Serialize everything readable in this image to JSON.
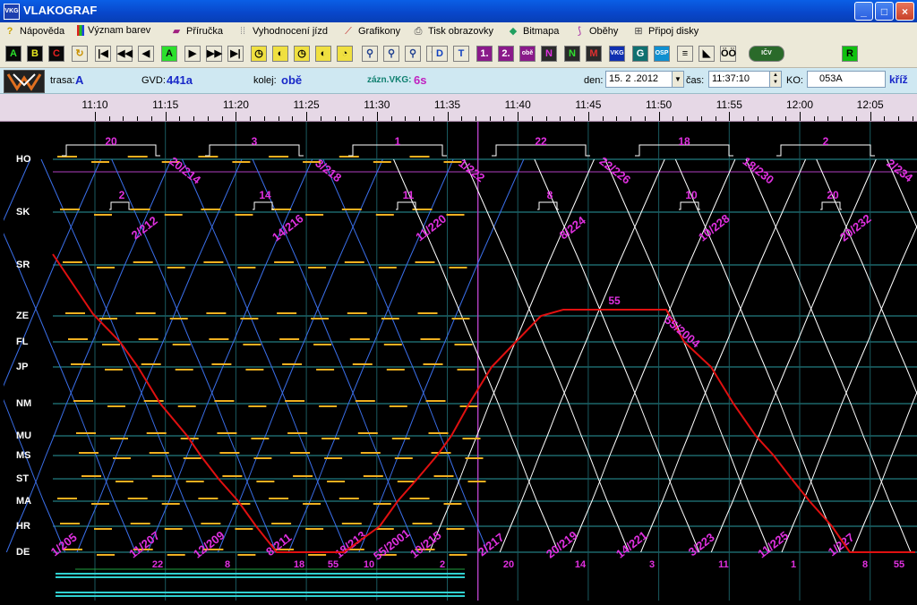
{
  "window": {
    "title": "VLAKOGRAF",
    "app_icon_text": "VKG",
    "buttons": {
      "minimize": "_",
      "maximize": "□",
      "close": "×"
    }
  },
  "menu": [
    {
      "label": "Nápověda",
      "icon": "question-icon"
    },
    {
      "label": "Význam barev",
      "icon": "color-bars-icon"
    },
    {
      "label": "Příručka",
      "icon": "book-icon"
    },
    {
      "label": "Vyhodnocení jízd",
      "icon": "evaluation-icon"
    },
    {
      "label": "Grafikony",
      "icon": "pencil-icon"
    },
    {
      "label": "Tisk obrazovky",
      "icon": "printer-icon"
    },
    {
      "label": "Bitmapa",
      "icon": "bitmap-icon"
    },
    {
      "label": "Oběhy",
      "icon": "circulation-icon"
    },
    {
      "label": "Připoj disky",
      "icon": "network-disk-icon"
    }
  ],
  "toolbar": [
    {
      "t": "A",
      "bg": "#0a0a0a",
      "fg": "#2ce02c"
    },
    {
      "t": "B",
      "bg": "#0a0a0a",
      "fg": "#e8e820"
    },
    {
      "t": "C",
      "bg": "#0a0a0a",
      "fg": "#e82020"
    },
    {
      "t": "↻",
      "bg": "#ece9d8",
      "fg": "#c89000"
    },
    {
      "t": "|◀",
      "bg": "#ece9d8",
      "fg": "#000"
    },
    {
      "t": "◀◀",
      "bg": "#ece9d8",
      "fg": "#000"
    },
    {
      "t": "◀",
      "bg": "#ece9d8",
      "fg": "#000"
    },
    {
      "t": "A",
      "bg": "#2ce02c",
      "fg": "#0a0a0a"
    },
    {
      "t": "▶",
      "bg": "#ece9d8",
      "fg": "#000"
    },
    {
      "t": "▶▶",
      "bg": "#ece9d8",
      "fg": "#000"
    },
    {
      "t": "▶|",
      "bg": "#ece9d8",
      "fg": "#000"
    },
    {
      "t": "◷",
      "bg": "#f0e040",
      "fg": "#000"
    },
    {
      "t": "◐",
      "bg": "#f0e040",
      "fg": "#000"
    },
    {
      "t": "◷",
      "bg": "#f0e040",
      "fg": "#000"
    },
    {
      "t": "◐",
      "bg": "#f0e040",
      "fg": "#000"
    },
    {
      "t": "◔",
      "bg": "#f0e040",
      "fg": "#000"
    },
    {
      "t": "⚲",
      "bg": "#ece9d8",
      "fg": "#204090"
    },
    {
      "t": "⚲",
      "bg": "#ece9d8",
      "fg": "#204090"
    },
    {
      "t": "⚲",
      "bg": "#ece9d8",
      "fg": "#204090"
    },
    {
      "t": "⚲",
      "bg": "#ece9d8",
      "fg": "#204090"
    },
    {
      "t": "D",
      "bg": "#ece9d8",
      "fg": "#1040c0"
    },
    {
      "t": "T",
      "bg": "#ece9d8",
      "fg": "#1040c0"
    },
    {
      "t": "1.",
      "bg": "#8a1a8a",
      "fg": "#fff"
    },
    {
      "t": "2.",
      "bg": "#8a1a8a",
      "fg": "#fff"
    },
    {
      "t": "obě",
      "bg": "#8a1a8a",
      "fg": "#fff"
    },
    {
      "t": "N",
      "bg": "#2a2a2a",
      "fg": "#e030e0"
    },
    {
      "t": "N",
      "bg": "#2a2a2a",
      "fg": "#30e030"
    },
    {
      "t": "M",
      "bg": "#2a2a2a",
      "fg": "#e03030"
    },
    {
      "t": "VKG",
      "bg": "#1030b0",
      "fg": "#fff"
    },
    {
      "t": "G",
      "bg": "#107070",
      "fg": "#fff"
    },
    {
      "t": "OSP",
      "bg": "#1090d0",
      "fg": "#fff"
    },
    {
      "t": "≡",
      "bg": "#ece9d8",
      "fg": "#000"
    },
    {
      "t": "◣",
      "bg": "#ece9d8",
      "fg": "#000"
    },
    {
      "t": "ÖÖ",
      "bg": "#ece9d8",
      "fg": "#000"
    },
    {
      "t": "IČV",
      "bg": "#2a6a2a",
      "fg": "#fff"
    },
    {
      "t": "R",
      "bg": "#10c010",
      "fg": "#000"
    }
  ],
  "info": {
    "trasa_label": "trasa:",
    "trasa_value": "A",
    "gvd_label": "GVD:",
    "gvd_value": "441a",
    "kolej_label": "kolej:",
    "kolej_value": "obě",
    "zazn_label": "zázn.VKG:",
    "zazn_value": "6s",
    "den_label": "den:",
    "den_value": "15. 2 .2012",
    "cas_label": "čas:",
    "cas_value": "11:37:10",
    "ko_label": "KO:",
    "ko_value": "053A",
    "kriz_label": "kříž"
  },
  "time_axis": {
    "ticks": [
      "11:10",
      "11:15",
      "11:20",
      "11:25",
      "11:30",
      "11:35",
      "11:40",
      "11:45",
      "11:50",
      "11:55",
      "12:00",
      "12:05"
    ]
  },
  "stations": [
    "HO",
    "SK",
    "SR",
    "ZE",
    "FL",
    "JP",
    "NM",
    "MU",
    "MS",
    "ST",
    "MA",
    "HR",
    "DE"
  ],
  "colors": {
    "background": "#000000",
    "grid": "#2a9aa0",
    "planned": "#ffffff",
    "recorded": "#3a6ee8",
    "dwell": "#f0b020",
    "highlight": "#e01010",
    "label": "#e030e0",
    "now_line": "#b040c0"
  },
  "top_labels": [
    {
      "t": "20",
      "m": 11.4
    },
    {
      "t": "3",
      "m": 11.4
    },
    {
      "t": "1",
      "m": 11.4
    },
    {
      "t": "22",
      "m": 11.4
    },
    {
      "t": "18",
      "m": 11.4
    },
    {
      "t": "2",
      "m": 11.4
    }
  ],
  "labels_top": [
    "20",
    "3",
    "1",
    "22",
    "18",
    "2"
  ],
  "labels_sk": [
    "2",
    "14",
    "11",
    "8",
    "10",
    "20"
  ],
  "diag_top": [
    "20/214",
    "3/218",
    "1/222",
    "22/226",
    "18/230",
    "2/234"
  ],
  "diag_sk": [
    "2/212",
    "14/216",
    "11/220",
    "8/224",
    "10/228",
    "20/232"
  ],
  "diag_bottom": [
    "1/205",
    "11/207",
    "12/209",
    "8/211",
    "18/213",
    "55/2001",
    "10/215",
    "2/217",
    "20/219",
    "14/221",
    "3/223",
    "11/225",
    "1/227"
  ],
  "bottom_nums": [
    "22",
    "8",
    "18",
    "55",
    "10",
    "2",
    "20",
    "14",
    "3",
    "11",
    "1",
    "8",
    "55"
  ],
  "red_label_top": "55",
  "red_label_diag": "55/2004"
}
